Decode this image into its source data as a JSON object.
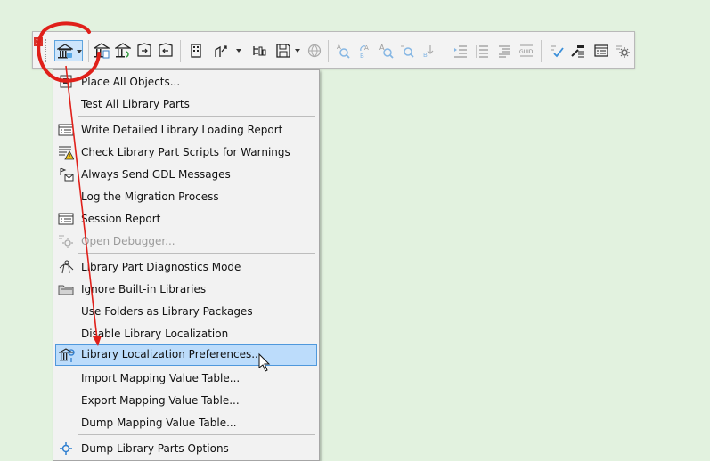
{
  "toolbar": {
    "close_label": "x",
    "buttons": [
      {
        "icon": "library-manager-icon"
      },
      {
        "icon": "library-report-icon"
      },
      {
        "icon": "reload-libraries-icon"
      },
      {
        "icon": "library-export-icon"
      },
      {
        "icon": "library-import-icon"
      },
      {
        "icon": "building-open-icon"
      },
      {
        "icon": "migration-icon"
      },
      {
        "icon": "object-tree-icon"
      },
      {
        "icon": "save-floppy-icon"
      },
      {
        "icon": "globe-icon"
      },
      {
        "icon": "find-a-icon"
      },
      {
        "icon": "replace-a-b-icon"
      },
      {
        "icon": "find-text-icon"
      },
      {
        "icon": "find-next-icon"
      },
      {
        "icon": "replace-next-icon"
      },
      {
        "icon": "indent-icon"
      },
      {
        "icon": "align-lines-icon"
      },
      {
        "icon": "paragraph-icon"
      },
      {
        "icon": "guid-icon"
      },
      {
        "icon": "check-script-icon"
      },
      {
        "icon": "compile-icon"
      },
      {
        "icon": "window-list-icon"
      },
      {
        "icon": "settings-gear-icon"
      }
    ]
  },
  "menu": {
    "items": [
      {
        "label": "Place All Objects...",
        "icon": "place-objects-icon",
        "state": "normal"
      },
      {
        "label": "Test All Library Parts",
        "icon": "",
        "state": "normal"
      },
      {
        "label": "Write Detailed Library Loading Report",
        "icon": "report-list-icon",
        "state": "normal"
      },
      {
        "label": "Check Library Part Scripts for Warnings",
        "icon": "warning-list-icon",
        "state": "normal"
      },
      {
        "label": "Always Send GDL Messages",
        "icon": "message-icon",
        "state": "normal"
      },
      {
        "label": "Log the Migration Process",
        "icon": "",
        "state": "normal"
      },
      {
        "label": "Session Report",
        "icon": "report-list-icon",
        "state": "normal"
      },
      {
        "label": "Open Debugger...",
        "icon": "debugger-gear-icon",
        "state": "disabled"
      },
      {
        "label": "Library Part Diagnostics Mode",
        "icon": "diagnostics-icon",
        "state": "normal"
      },
      {
        "label": "Ignore Built-in Libraries",
        "icon": "folder-icon",
        "state": "normal"
      },
      {
        "label": "Use Folders as Library Packages",
        "icon": "",
        "state": "normal"
      },
      {
        "label": "Disable Library Localization",
        "icon": "",
        "state": "normal"
      },
      {
        "label": "Library Localization Preferences...",
        "icon": "library-localization-icon",
        "state": "selected"
      },
      {
        "label": "Import Mapping Value Table...",
        "icon": "",
        "state": "normal"
      },
      {
        "label": "Export Mapping Value Table...",
        "icon": "",
        "state": "normal"
      },
      {
        "label": "Dump Mapping Value Table...",
        "icon": "",
        "state": "normal"
      },
      {
        "label": "Dump Library Parts Options",
        "icon": "gear-options-icon",
        "state": "normal"
      }
    ]
  },
  "annotation": {
    "color": "#e0201a"
  }
}
